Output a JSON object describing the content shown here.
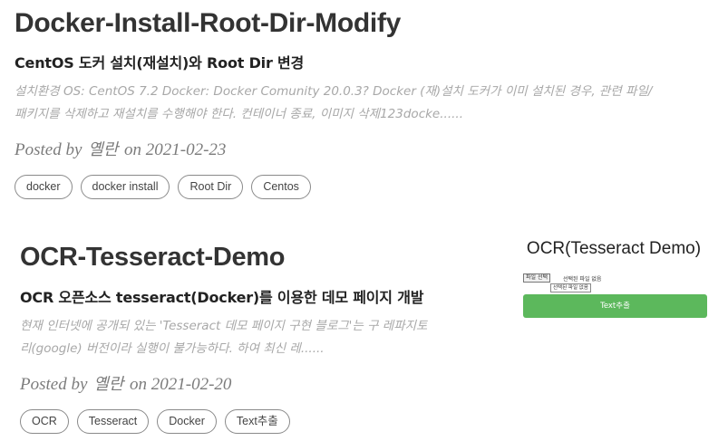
{
  "posts": [
    {
      "title": "Docker-Install-Root-Dir-Modify",
      "subtitle": "CentOS 도커 설치(재설치)와 Root Dir 변경",
      "excerpt_line1": "설치환경 OS: CentOS 7.2 Docker: Docker Comunity 20.0.3? Docker (재)설치 도커가 이미 설치된 경우, 관련 파일/",
      "excerpt_line2": "패키지를 삭제하고 재설치를 수행해야 한다. 컨테이너 종료, 이미지 삭제123docke......",
      "posted_by": "Posted by",
      "author": "옐란",
      "on": "on",
      "date": "2021-02-23",
      "tags": [
        "docker",
        "docker install",
        "Root Dir",
        "Centos"
      ]
    },
    {
      "title": "OCR-Tesseract-Demo",
      "subtitle": "OCR 오픈소스 tesseract(Docker)를 이용한 데모 페이지 개발",
      "excerpt_line1": "현재 인터넷에 공개되 있는 'Tesseract 데모 페이지 구현 블로그'는 구 레파지토",
      "excerpt_line2": "리(google) 버전이라 실행이 불가능하다. 하여 최신 레......",
      "posted_by": "Posted by",
      "author": "옐란",
      "on": "on",
      "date": "2021-02-20",
      "tags": [
        "OCR",
        "Tesseract",
        "Docker",
        "Text추출"
      ],
      "thumbnail": {
        "title": "OCR(Tesseract Demo)",
        "file_button": "파일 선택",
        "file_status": "선택된 파일 없음",
        "tooltip": "선택된 파일 없음",
        "extract_button": "Text추출",
        "accent_color": "#5cb85c"
      }
    }
  ]
}
